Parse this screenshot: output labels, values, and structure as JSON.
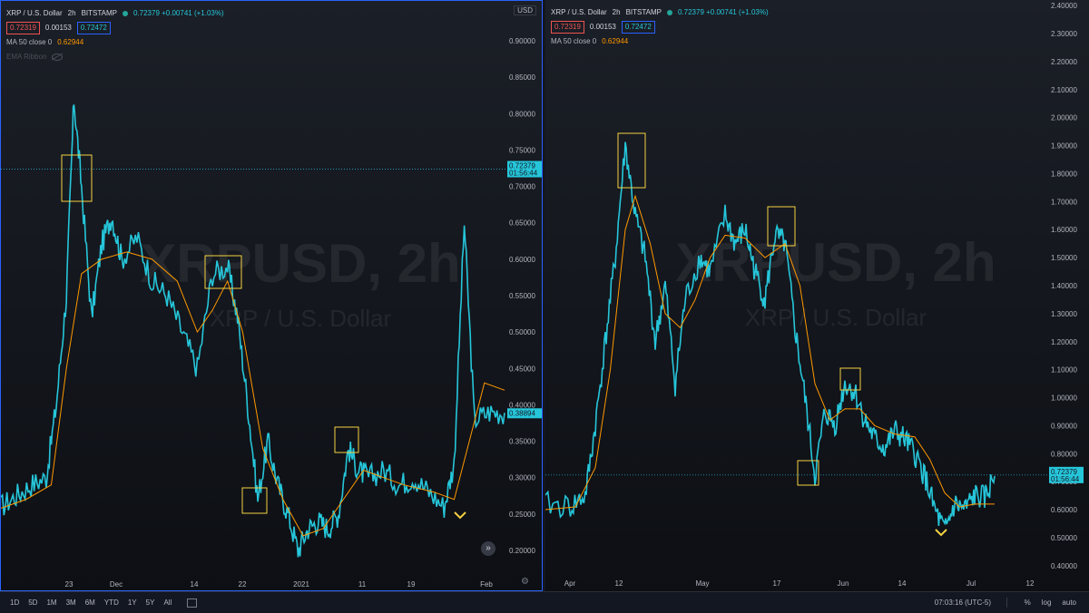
{
  "left_chart": {
    "symbol": "XRP / U.S. Dollar",
    "interval": "2h",
    "exchange": "BITSTAMP",
    "quote": "0.72379 +0.00741 (+1.03%)",
    "bid": "0.72319",
    "spread": "0.00153",
    "ask": "0.72472",
    "ma_label": "MA 50 close 0",
    "ma_value": "0.62944",
    "ribbon_label": "EMA Ribbon",
    "watermark_title": "XRPUSD, 2h",
    "watermark_sub": "XRP / U.S. Dollar",
    "currency": "USD",
    "price_tag": "0.72379",
    "countdown": "01:56:44",
    "ma_tag": "0.38894",
    "y_ticks": [
      "0.90000",
      "0.85000",
      "0.80000",
      "0.75000",
      "0.70000",
      "0.65000",
      "0.60000",
      "0.55000",
      "0.50000",
      "0.45000",
      "0.40000",
      "0.35000",
      "0.30000",
      "0.25000",
      "0.20000"
    ],
    "x_ticks": [
      "23",
      "Dec",
      "14",
      "22",
      "2021",
      "11",
      "19",
      "Feb"
    ],
    "scroll_btn": "»"
  },
  "right_chart": {
    "symbol": "XRP / U.S. Dollar",
    "interval": "2h",
    "exchange": "BITSTAMP",
    "quote": "0.72379 +0.00741 (+1.03%)",
    "bid": "0.72319",
    "spread": "0.00153",
    "ask": "0.72472",
    "ma_label": "MA 50 close 0",
    "ma_value": "0.62944",
    "watermark_title": "XRPUSD, 2h",
    "watermark_sub": "XRP / U.S. Dollar",
    "price_tag": "0.72379",
    "countdown": "01:56:44",
    "y_ticks": [
      "2.40000",
      "2.30000",
      "2.20000",
      "2.10000",
      "2.00000",
      "1.90000",
      "1.80000",
      "1.70000",
      "1.60000",
      "1.50000",
      "1.40000",
      "1.30000",
      "1.20000",
      "1.10000",
      "1.00000",
      "0.90000",
      "0.80000",
      "0.70000",
      "0.60000",
      "0.50000",
      "0.40000"
    ],
    "x_ticks": [
      "Apr",
      "12",
      "May",
      "17",
      "Jun",
      "14",
      "Jul",
      "12"
    ]
  },
  "chart_data": [
    {
      "type": "line",
      "series": [
        {
          "values": [
            [
              0,
              0.26
            ],
            [
              0.03,
              0.275
            ],
            [
              0.06,
              0.29
            ],
            [
              0.09,
              0.3
            ],
            [
              0.11,
              0.4
            ],
            [
              0.13,
              0.55
            ],
            [
              0.145,
              0.82
            ],
            [
              0.16,
              0.7
            ],
            [
              0.18,
              0.52
            ],
            [
              0.2,
              0.62
            ],
            [
              0.22,
              0.66
            ],
            [
              0.24,
              0.6
            ],
            [
              0.27,
              0.63
            ],
            [
              0.3,
              0.57
            ],
            [
              0.33,
              0.55
            ],
            [
              0.36,
              0.5
            ],
            [
              0.39,
              0.45
            ],
            [
              0.42,
              0.58
            ],
            [
              0.45,
              0.59
            ],
            [
              0.47,
              0.52
            ],
            [
              0.49,
              0.4
            ],
            [
              0.51,
              0.27
            ],
            [
              0.53,
              0.35
            ],
            [
              0.55,
              0.29
            ],
            [
              0.57,
              0.25
            ],
            [
              0.59,
              0.2
            ],
            [
              0.61,
              0.23
            ],
            [
              0.63,
              0.24
            ],
            [
              0.65,
              0.23
            ],
            [
              0.67,
              0.25
            ],
            [
              0.69,
              0.34
            ],
            [
              0.71,
              0.31
            ],
            [
              0.73,
              0.3
            ],
            [
              0.76,
              0.31
            ],
            [
              0.79,
              0.29
            ],
            [
              0.82,
              0.3
            ],
            [
              0.85,
              0.28
            ],
            [
              0.88,
              0.26
            ],
            [
              0.9,
              0.32
            ],
            [
              0.92,
              0.65
            ],
            [
              0.94,
              0.38
            ],
            [
              0.97,
              0.39
            ],
            [
              1.0,
              0.389
            ]
          ]
        },
        {
          "name": "MA 50 close 0",
          "values": [
            [
              0,
              0.258
            ],
            [
              0.05,
              0.27
            ],
            [
              0.1,
              0.29
            ],
            [
              0.13,
              0.45
            ],
            [
              0.16,
              0.58
            ],
            [
              0.2,
              0.6
            ],
            [
              0.25,
              0.61
            ],
            [
              0.3,
              0.6
            ],
            [
              0.35,
              0.57
            ],
            [
              0.39,
              0.5
            ],
            [
              0.42,
              0.53
            ],
            [
              0.45,
              0.57
            ],
            [
              0.48,
              0.5
            ],
            [
              0.52,
              0.34
            ],
            [
              0.56,
              0.27
            ],
            [
              0.6,
              0.22
            ],
            [
              0.64,
              0.23
            ],
            [
              0.68,
              0.27
            ],
            [
              0.72,
              0.31
            ],
            [
              0.76,
              0.3
            ],
            [
              0.8,
              0.29
            ],
            [
              0.86,
              0.28
            ],
            [
              0.9,
              0.27
            ],
            [
              0.93,
              0.35
            ],
            [
              0.96,
              0.43
            ],
            [
              1.0,
              0.42
            ]
          ]
        }
      ],
      "ylim": [
        0.17,
        0.93
      ]
    },
    {
      "type": "line",
      "series": [
        {
          "values": [
            [
              0,
              0.62
            ],
            [
              0.05,
              0.61
            ],
            [
              0.08,
              0.65
            ],
            [
              0.1,
              0.9
            ],
            [
              0.12,
              1.2
            ],
            [
              0.14,
              1.5
            ],
            [
              0.16,
              1.9
            ],
            [
              0.18,
              1.65
            ],
            [
              0.2,
              1.5
            ],
            [
              0.22,
              1.2
            ],
            [
              0.24,
              1.4
            ],
            [
              0.26,
              1.05
            ],
            [
              0.28,
              1.35
            ],
            [
              0.31,
              1.5
            ],
            [
              0.33,
              1.45
            ],
            [
              0.36,
              1.65
            ],
            [
              0.38,
              1.55
            ],
            [
              0.4,
              1.6
            ],
            [
              0.42,
              1.45
            ],
            [
              0.44,
              1.35
            ],
            [
              0.46,
              1.58
            ],
            [
              0.48,
              1.55
            ],
            [
              0.5,
              1.25
            ],
            [
              0.52,
              1.0
            ],
            [
              0.54,
              0.72
            ],
            [
              0.56,
              0.95
            ],
            [
              0.58,
              0.9
            ],
            [
              0.6,
              1.05
            ],
            [
              0.62,
              1.02
            ],
            [
              0.64,
              0.92
            ],
            [
              0.66,
              0.85
            ],
            [
              0.68,
              0.82
            ],
            [
              0.7,
              0.88
            ],
            [
              0.72,
              0.85
            ],
            [
              0.74,
              0.8
            ],
            [
              0.76,
              0.72
            ],
            [
              0.78,
              0.6
            ],
            [
              0.8,
              0.52
            ],
            [
              0.82,
              0.62
            ],
            [
              0.84,
              0.6
            ],
            [
              0.86,
              0.65
            ],
            [
              0.88,
              0.64
            ],
            [
              0.9,
              0.72
            ]
          ]
        },
        {
          "name": "MA 50 close 0",
          "values": [
            [
              0,
              0.6
            ],
            [
              0.06,
              0.61
            ],
            [
              0.1,
              0.75
            ],
            [
              0.13,
              1.1
            ],
            [
              0.16,
              1.6
            ],
            [
              0.18,
              1.72
            ],
            [
              0.21,
              1.55
            ],
            [
              0.24,
              1.3
            ],
            [
              0.27,
              1.25
            ],
            [
              0.3,
              1.35
            ],
            [
              0.33,
              1.5
            ],
            [
              0.36,
              1.58
            ],
            [
              0.4,
              1.57
            ],
            [
              0.44,
              1.5
            ],
            [
              0.48,
              1.55
            ],
            [
              0.51,
              1.4
            ],
            [
              0.54,
              1.05
            ],
            [
              0.57,
              0.92
            ],
            [
              0.6,
              0.96
            ],
            [
              0.63,
              0.96
            ],
            [
              0.66,
              0.9
            ],
            [
              0.7,
              0.87
            ],
            [
              0.74,
              0.86
            ],
            [
              0.77,
              0.78
            ],
            [
              0.8,
              0.66
            ],
            [
              0.83,
              0.61
            ],
            [
              0.86,
              0.62
            ],
            [
              0.9,
              0.62
            ]
          ]
        }
      ],
      "ylim": [
        0.38,
        2.42
      ]
    }
  ],
  "toolbar": {
    "ranges": [
      "1D",
      "5D",
      "1M",
      "3M",
      "6M",
      "YTD",
      "1Y",
      "5Y",
      "All"
    ],
    "time": "07:03:16 (UTC-5)",
    "percent": "%",
    "log": "log",
    "auto": "auto"
  },
  "colors": {
    "price_line": "#26c6da",
    "ma_line": "#ff9800",
    "highlight_box": "#f5d142",
    "selection_border": "#2962ff",
    "background": "#131722"
  }
}
